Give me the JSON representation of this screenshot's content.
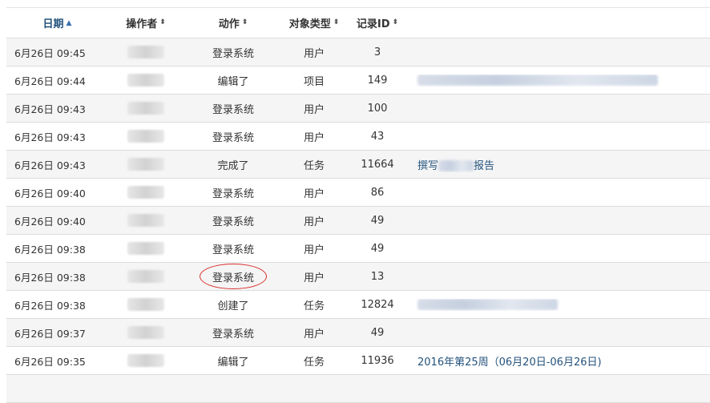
{
  "headers": {
    "date": "日期",
    "operator": "操作者",
    "action": "动作",
    "object_type": "对象类型",
    "record_id": "记录ID"
  },
  "sort_icons": {
    "active_asc": "▲",
    "unsorted": "⬍"
  },
  "rows": [
    {
      "date": "6月26日 09:45",
      "action": "登录系统",
      "type": "用户",
      "id": "3",
      "title": ""
    },
    {
      "date": "6月26日 09:44",
      "action": "编辑了",
      "type": "项目",
      "id": "149",
      "title": ""
    },
    {
      "date": "6月26日 09:43",
      "action": "登录系统",
      "type": "用户",
      "id": "100",
      "title": ""
    },
    {
      "date": "6月26日 09:43",
      "action": "登录系统",
      "type": "用户",
      "id": "43",
      "title": ""
    },
    {
      "date": "6月26日 09:43",
      "action": "完成了",
      "type": "任务",
      "id": "11664",
      "title": "撰写",
      "title_end": "报告"
    },
    {
      "date": "6月26日 09:40",
      "action": "登录系统",
      "type": "用户",
      "id": "86",
      "title": ""
    },
    {
      "date": "6月26日 09:40",
      "action": "登录系统",
      "type": "用户",
      "id": "49",
      "title": ""
    },
    {
      "date": "6月26日 09:38",
      "action": "登录系统",
      "type": "用户",
      "id": "49",
      "title": ""
    },
    {
      "date": "6月26日 09:38",
      "action": "登录系统",
      "type": "用户",
      "id": "13",
      "title": ""
    },
    {
      "date": "6月26日 09:38",
      "action": "创建了",
      "type": "任务",
      "id": "12824",
      "title": ""
    },
    {
      "date": "6月26日 09:37",
      "action": "登录系统",
      "type": "用户",
      "id": "49",
      "title": ""
    },
    {
      "date": "6月26日 09:35",
      "action": "编辑了",
      "type": "任务",
      "id": "11936",
      "title": "2016年第25周（06月20日-06月26日)"
    }
  ]
}
